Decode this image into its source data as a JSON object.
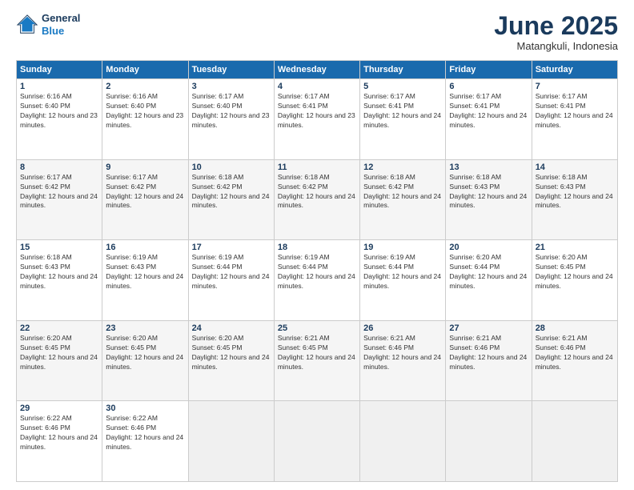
{
  "header": {
    "logo_line1": "General",
    "logo_line2": "Blue",
    "month": "June 2025",
    "location": "Matangkuli, Indonesia"
  },
  "weekdays": [
    "Sunday",
    "Monday",
    "Tuesday",
    "Wednesday",
    "Thursday",
    "Friday",
    "Saturday"
  ],
  "weeks": [
    [
      {
        "day": "1",
        "rise": "6:16 AM",
        "set": "6:40 PM",
        "daylight": "12 hours and 23 minutes."
      },
      {
        "day": "2",
        "rise": "6:16 AM",
        "set": "6:40 PM",
        "daylight": "12 hours and 23 minutes."
      },
      {
        "day": "3",
        "rise": "6:17 AM",
        "set": "6:40 PM",
        "daylight": "12 hours and 23 minutes."
      },
      {
        "day": "4",
        "rise": "6:17 AM",
        "set": "6:41 PM",
        "daylight": "12 hours and 23 minutes."
      },
      {
        "day": "5",
        "rise": "6:17 AM",
        "set": "6:41 PM",
        "daylight": "12 hours and 24 minutes."
      },
      {
        "day": "6",
        "rise": "6:17 AM",
        "set": "6:41 PM",
        "daylight": "12 hours and 24 minutes."
      },
      {
        "day": "7",
        "rise": "6:17 AM",
        "set": "6:41 PM",
        "daylight": "12 hours and 24 minutes."
      }
    ],
    [
      {
        "day": "8",
        "rise": "6:17 AM",
        "set": "6:42 PM",
        "daylight": "12 hours and 24 minutes."
      },
      {
        "day": "9",
        "rise": "6:17 AM",
        "set": "6:42 PM",
        "daylight": "12 hours and 24 minutes."
      },
      {
        "day": "10",
        "rise": "6:18 AM",
        "set": "6:42 PM",
        "daylight": "12 hours and 24 minutes."
      },
      {
        "day": "11",
        "rise": "6:18 AM",
        "set": "6:42 PM",
        "daylight": "12 hours and 24 minutes."
      },
      {
        "day": "12",
        "rise": "6:18 AM",
        "set": "6:42 PM",
        "daylight": "12 hours and 24 minutes."
      },
      {
        "day": "13",
        "rise": "6:18 AM",
        "set": "6:43 PM",
        "daylight": "12 hours and 24 minutes."
      },
      {
        "day": "14",
        "rise": "6:18 AM",
        "set": "6:43 PM",
        "daylight": "12 hours and 24 minutes."
      }
    ],
    [
      {
        "day": "15",
        "rise": "6:18 AM",
        "set": "6:43 PM",
        "daylight": "12 hours and 24 minutes."
      },
      {
        "day": "16",
        "rise": "6:19 AM",
        "set": "6:43 PM",
        "daylight": "12 hours and 24 minutes."
      },
      {
        "day": "17",
        "rise": "6:19 AM",
        "set": "6:44 PM",
        "daylight": "12 hours and 24 minutes."
      },
      {
        "day": "18",
        "rise": "6:19 AM",
        "set": "6:44 PM",
        "daylight": "12 hours and 24 minutes."
      },
      {
        "day": "19",
        "rise": "6:19 AM",
        "set": "6:44 PM",
        "daylight": "12 hours and 24 minutes."
      },
      {
        "day": "20",
        "rise": "6:20 AM",
        "set": "6:44 PM",
        "daylight": "12 hours and 24 minutes."
      },
      {
        "day": "21",
        "rise": "6:20 AM",
        "set": "6:45 PM",
        "daylight": "12 hours and 24 minutes."
      }
    ],
    [
      {
        "day": "22",
        "rise": "6:20 AM",
        "set": "6:45 PM",
        "daylight": "12 hours and 24 minutes."
      },
      {
        "day": "23",
        "rise": "6:20 AM",
        "set": "6:45 PM",
        "daylight": "12 hours and 24 minutes."
      },
      {
        "day": "24",
        "rise": "6:20 AM",
        "set": "6:45 PM",
        "daylight": "12 hours and 24 minutes."
      },
      {
        "day": "25",
        "rise": "6:21 AM",
        "set": "6:45 PM",
        "daylight": "12 hours and 24 minutes."
      },
      {
        "day": "26",
        "rise": "6:21 AM",
        "set": "6:46 PM",
        "daylight": "12 hours and 24 minutes."
      },
      {
        "day": "27",
        "rise": "6:21 AM",
        "set": "6:46 PM",
        "daylight": "12 hours and 24 minutes."
      },
      {
        "day": "28",
        "rise": "6:21 AM",
        "set": "6:46 PM",
        "daylight": "12 hours and 24 minutes."
      }
    ],
    [
      {
        "day": "29",
        "rise": "6:22 AM",
        "set": "6:46 PM",
        "daylight": "12 hours and 24 minutes."
      },
      {
        "day": "30",
        "rise": "6:22 AM",
        "set": "6:46 PM",
        "daylight": "12 hours and 24 minutes."
      },
      null,
      null,
      null,
      null,
      null
    ]
  ]
}
